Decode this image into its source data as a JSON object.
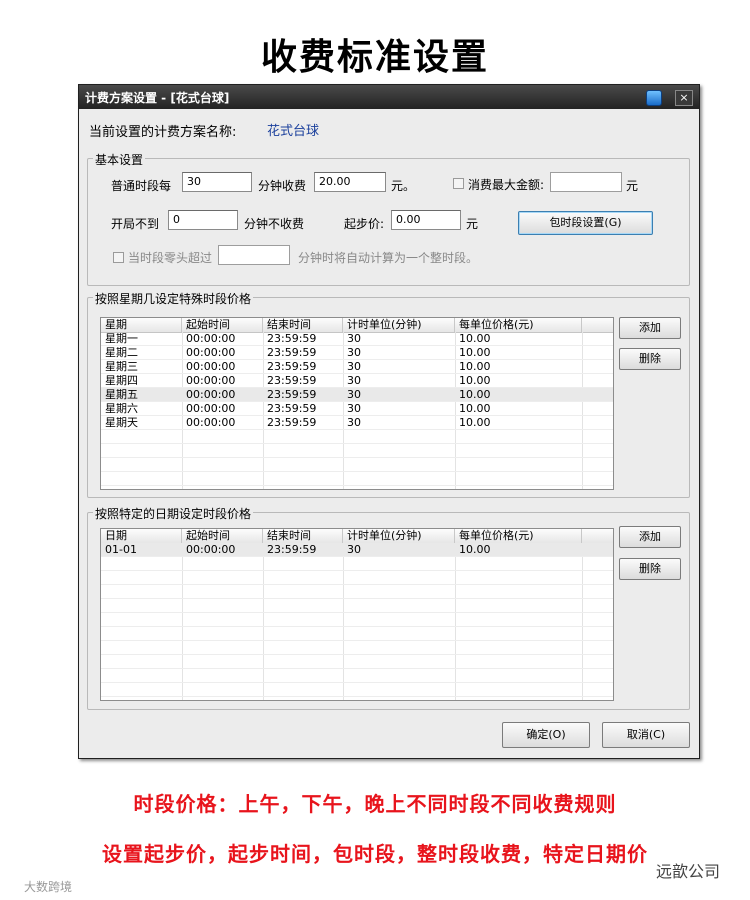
{
  "page_title": "收费标准设置",
  "window": {
    "title": "计费方案设置 - [花式台球]",
    "close_glyph": "×",
    "scheme_label": "当前设置的计费方案名称:",
    "scheme_name": "花式台球"
  },
  "basic": {
    "group_title": "基本设置",
    "normal_period_label": "普通时段每",
    "normal_period_value": "30",
    "minute_fee_label": "分钟收费",
    "minute_fee_value": "20.00",
    "yuan_dot": "元。",
    "max_fee_label": "消费最大金额:",
    "max_fee_value": "",
    "yuan": "元",
    "free_label": "开局不到",
    "free_value": "0",
    "free_suffix": "分钟不收费",
    "start_price_label": "起步价:",
    "start_price_value": "0.00",
    "package_button": "包时段设置(G)",
    "remainder_label": "当时段零头超过",
    "remainder_value": "",
    "remainder_suffix": "分钟时将自动计算为一个整时段。"
  },
  "weekday": {
    "group_title": "按照星期几设定特殊时段价格",
    "headers": [
      "星期",
      "起始时间",
      "结束时间",
      "计时单位(分钟)",
      "每单位价格(元)"
    ],
    "rows": [
      [
        "星期一",
        "00:00:00",
        "23:59:59",
        "30",
        "10.00"
      ],
      [
        "星期二",
        "00:00:00",
        "23:59:59",
        "30",
        "10.00"
      ],
      [
        "星期三",
        "00:00:00",
        "23:59:59",
        "30",
        "10.00"
      ],
      [
        "星期四",
        "00:00:00",
        "23:59:59",
        "30",
        "10.00"
      ],
      [
        "星期五",
        "00:00:00",
        "23:59:59",
        "30",
        "10.00"
      ],
      [
        "星期六",
        "00:00:00",
        "23:59:59",
        "30",
        "10.00"
      ],
      [
        "星期天",
        "00:00:00",
        "23:59:59",
        "30",
        "10.00"
      ]
    ],
    "add_button": "添加",
    "delete_button": "删除"
  },
  "date": {
    "group_title": "按照特定的日期设定时段价格",
    "headers": [
      "日期",
      "起始时间",
      "结束时间",
      "计时单位(分钟)",
      "每单位价格(元)"
    ],
    "rows": [
      [
        "01-01",
        "00:00:00",
        "23:59:59",
        "30",
        "10.00"
      ]
    ],
    "add_button": "添加",
    "delete_button": "删除"
  },
  "footer": {
    "ok_button": "确定(O)",
    "cancel_button": "取消(C)"
  },
  "captions": {
    "line1": "时段价格：上午，下午，晚上不同时段不同收费规则",
    "line2": "设置起步价，起步时间，包时段，整时段收费，特定日期价"
  },
  "watermarks": {
    "left": "大数跨境",
    "right": "远歆公司"
  },
  "colors": {
    "caption_red": "#e8141c",
    "scheme_name_blue": "#1a3f9c",
    "titlebar": "#2f2f2f"
  }
}
